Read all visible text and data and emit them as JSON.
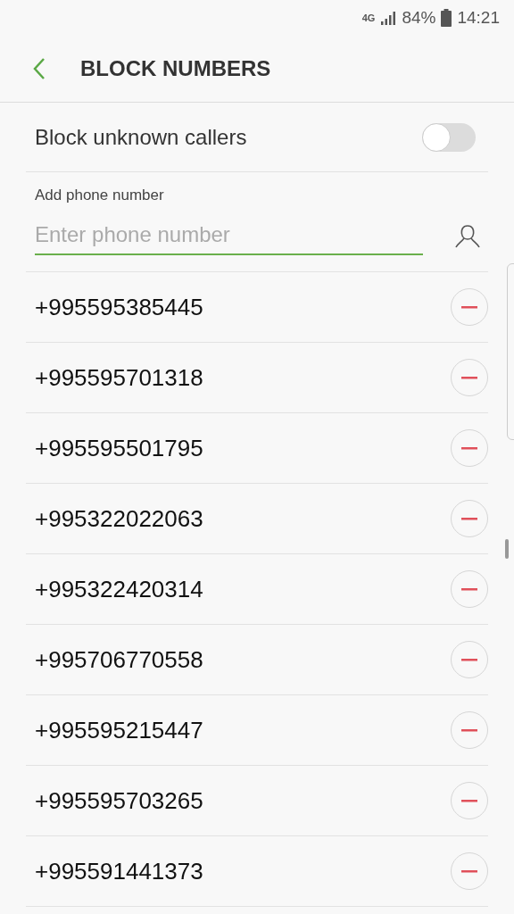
{
  "status_bar": {
    "network": "4G",
    "battery": "84%",
    "time": "14:21"
  },
  "header": {
    "title": "BLOCK NUMBERS"
  },
  "block_unknown": {
    "label": "Block unknown callers",
    "on": false
  },
  "add_number": {
    "label": "Add phone number",
    "placeholder": "Enter phone number"
  },
  "numbers": [
    {
      "number": "+995595385445"
    },
    {
      "number": "+995595701318"
    },
    {
      "number": "+995595501795"
    },
    {
      "number": "+995322022063"
    },
    {
      "number": "+995322420314"
    },
    {
      "number": "+995706770558"
    },
    {
      "number": "+995595215447"
    },
    {
      "number": "+995595703265"
    },
    {
      "number": "+995591441373"
    }
  ]
}
